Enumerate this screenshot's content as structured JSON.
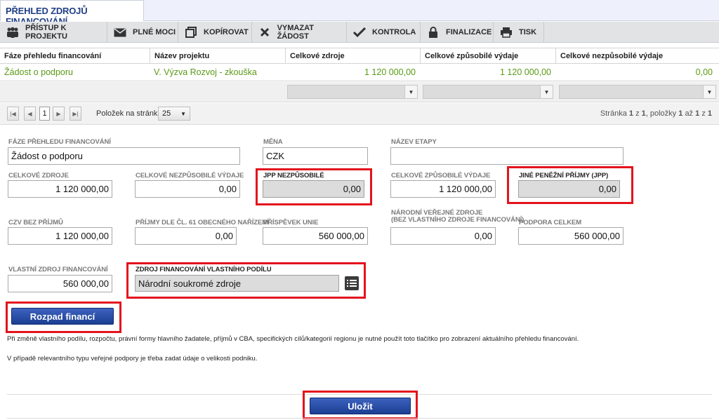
{
  "title": "PŘEHLED ZDROJŮ FINANCOVÁNÍ",
  "toolbar": {
    "access": "PŘÍSTUP K PROJEKTU",
    "power": "PLNÉ MOCI",
    "copy": "KOPÍROVAT",
    "delete": "VYMAZAT ŽÁDOST",
    "check": "KONTROLA",
    "finalize": "FINALIZACE",
    "print": "TISK"
  },
  "table": {
    "headers": [
      "Fáze přehledu financování",
      "Název projektu",
      "Celkové zdroje",
      "Celkové způsobilé výdaje",
      "Celkové nezpůsobilé výdaje"
    ],
    "row": [
      "Žádost o podporu",
      "V. Výzva Rozvoj - zkouška",
      "1 120 000,00",
      "1 120 000,00",
      "0,00"
    ]
  },
  "pager": {
    "page": "1",
    "per_page_label": "Položek na stránku",
    "per_page": "25",
    "info_prefix": "Stránka",
    "page_num": "1",
    "info_of": "z",
    "total_pages": "1",
    "info_items": ", položky",
    "from": "1",
    "info_to": "až",
    "to": "1",
    "info_of2": "z",
    "total_items": "1"
  },
  "form": {
    "phase_label": "FÁZE PŘEHLEDU FINANCOVÁNÍ",
    "phase_value": "Žádost o podporu",
    "currency_label": "MĚNA",
    "currency_value": "CZK",
    "stage_label": "NÁZEV ETAPY",
    "stage_value": "",
    "total_sources_label": "CELKOVÉ ZDROJE",
    "total_sources_value": "1 120 000,00",
    "ineligible_label": "CELKOVÉ NEZPŮSOBILÉ VÝDAJE",
    "ineligible_value": "0,00",
    "jpp_ineligible_label": "JPP NEZPŮSOBILÉ",
    "jpp_ineligible_value": "0,00",
    "eligible_label": "CELKOVÉ ZPŮSOBILÉ VÝDAJE",
    "eligible_value": "1 120 000,00",
    "other_income_label": "JINÉ PENĚŽNÍ PŘÍJMY (JPP)",
    "other_income_value": "0,00",
    "czv_label": "CZV BEZ PŘÍJMŮ",
    "czv_value": "1 120 000,00",
    "income61_label": "PŘÍJMY DLE ČL. 61 OBECNÉHO NAŘÍZENÍ",
    "income61_value": "0,00",
    "eu_label": "PŘÍSPĚVEK UNIE",
    "eu_value": "560 000,00",
    "national_label_1": "NÁRODNÍ VEŘEJNÉ ZDROJE",
    "national_label_2": "(BEZ VLASTNÍHO ZDROJE FINANCOVÁNÍ)",
    "national_value": "0,00",
    "support_label": "PODPORA CELKEM",
    "support_value": "560 000,00",
    "own_label": "VLASTNÍ ZDROJ FINANCOVÁNÍ",
    "own_value": "560 000,00",
    "own_source_label": "ZDROJ FINANCOVÁNÍ VLASTNÍHO PODÍLU",
    "own_source_value": "Národní soukromé zdroje"
  },
  "buttons": {
    "breakdown": "Rozpad financí",
    "save": "Uložit"
  },
  "notes": {
    "note1": "Při změně vlastního podílu, rozpočtu, právní formy hlavního žadatele, příjmů v CBA, specifických cílů/kategorií regionu je nutné použít toto tlačítko pro zobrazení aktuálního přehledu financování.",
    "note2": "V případě relevantního typu veřejné podpory je třeba zadat údaje o velikosti podniku."
  },
  "colors": {
    "highlight": "#e3131d",
    "title": "#1f3f86",
    "link_green": "#5a9a16",
    "button_blue": "#1b3f92"
  }
}
